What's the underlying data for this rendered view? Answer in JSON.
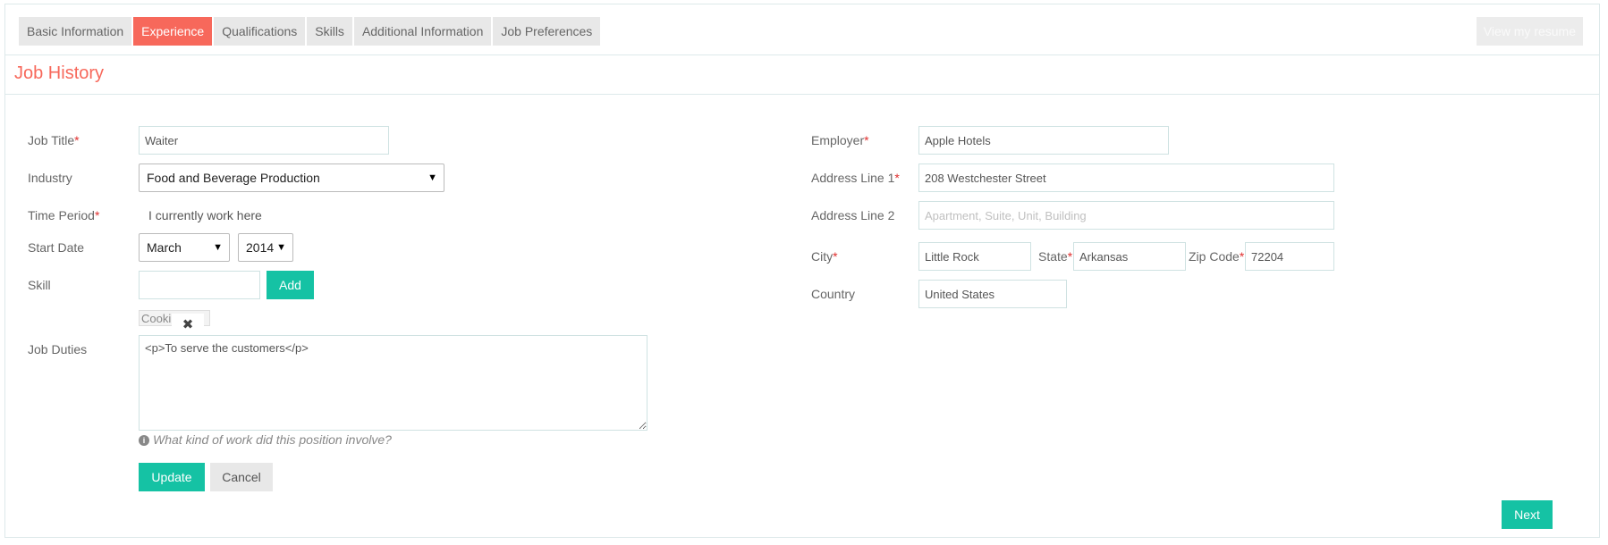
{
  "tabs": [
    {
      "label": "Basic Information",
      "active": false
    },
    {
      "label": "Experience",
      "active": true
    },
    {
      "label": "Qualifications",
      "active": false
    },
    {
      "label": "Skills",
      "active": false
    },
    {
      "label": "Additional Information",
      "active": false
    },
    {
      "label": "Job Preferences",
      "active": false
    }
  ],
  "view_resume_label": "View my resume",
  "section_title": "Job History",
  "required_mark": "*",
  "left_form": {
    "job_title": {
      "label": "Job Title",
      "value": "Waiter"
    },
    "industry": {
      "label": "Industry",
      "value": "Food and Beverage Production"
    },
    "time_period": {
      "label": "Time Period",
      "option_label": "I currently work here"
    },
    "start_date": {
      "label": "Start Date",
      "month": "March",
      "year": "2014"
    },
    "skill": {
      "label": "Skill",
      "value": "",
      "add_label": "Add",
      "chip": "Cooking",
      "chip_close": "✖"
    },
    "job_duties": {
      "label": "Job Duties",
      "value": "<p>To serve the customers</p>",
      "hint": "What kind of work did this position involve?",
      "hint_icon": "info-icon"
    }
  },
  "right_form": {
    "employer": {
      "label": "Employer",
      "value": "Apple Hotels"
    },
    "address1": {
      "label": "Address Line 1",
      "value": "208 Westchester Street"
    },
    "address2": {
      "label": "Address Line 2",
      "value": "",
      "placeholder": "Apartment, Suite, Unit, Building"
    },
    "city": {
      "label": "City",
      "value": "Little Rock"
    },
    "state": {
      "label": "State",
      "value": "Arkansas"
    },
    "zip": {
      "label": "Zip Code",
      "value": "72204"
    },
    "country": {
      "label": "Country",
      "value": "United States"
    }
  },
  "actions": {
    "update_label": "Update",
    "cancel_label": "Cancel",
    "next_label": "Next"
  },
  "colors": {
    "accent": "#f7685b",
    "primary_button": "#15c2a4",
    "required": "#e0302f"
  }
}
